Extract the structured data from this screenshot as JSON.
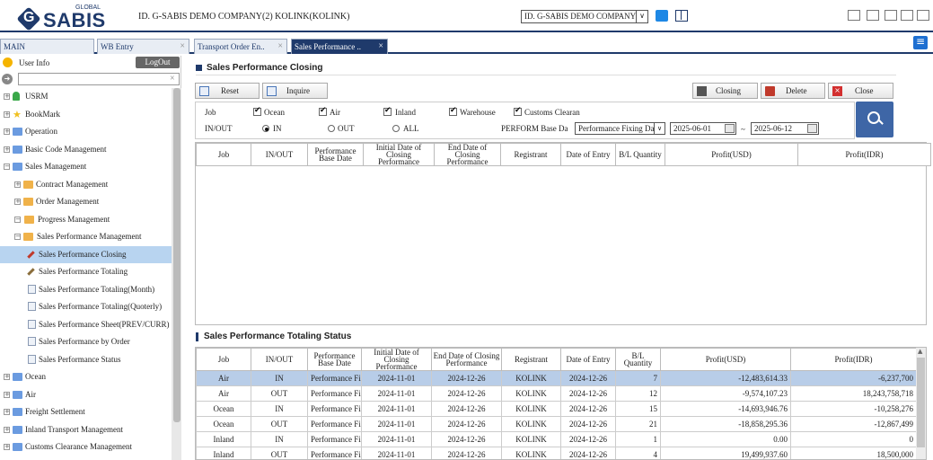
{
  "header": {
    "logo_global": "GLOBAL",
    "logo_word": "SABIS",
    "logo_mark": "G",
    "id_text": "ID. G-SABIS DEMO COMPANY(2) KOLINK(KOLINK)",
    "company_select": "ID. G-SABIS DEMO COMPANY",
    "icons": [
      "chat-icon",
      "book-icon",
      "window-cascade-icon",
      "window-tile-icon",
      "window-minimize-icon",
      "window-split-icon",
      "settings-icon"
    ]
  },
  "tabs": [
    {
      "label": "MAIN"
    },
    {
      "label": "WB Entry"
    },
    {
      "label": "Transport Order En.."
    },
    {
      "label": "Sales Performance .."
    }
  ],
  "sidebar": {
    "user_info": "User Info",
    "logout": "LogOut",
    "search_placeholder": "",
    "tree": [
      {
        "label": "USRM"
      },
      {
        "label": "BookMark"
      },
      {
        "label": "Operation"
      },
      {
        "label": "Basic Code Management"
      },
      {
        "label": "Sales Management"
      },
      {
        "label": "Contract Management"
      },
      {
        "label": "Order Management"
      },
      {
        "label": "Progress Management"
      },
      {
        "label": "Sales Performance Management"
      },
      {
        "label": "Sales Performance Closing"
      },
      {
        "label": "Sales Performance Totaling"
      },
      {
        "label": "Sales Performance Totaling(Month)"
      },
      {
        "label": "Sales Performance Totaling(Quoterly)"
      },
      {
        "label": "Sales Performance Sheet(PREV/CURR)"
      },
      {
        "label": "Sales Performance by Order"
      },
      {
        "label": "Sales Performance Status"
      },
      {
        "label": "Ocean"
      },
      {
        "label": "Air"
      },
      {
        "label": "Freight Settlement"
      },
      {
        "label": "Inland Transport Management"
      },
      {
        "label": "Customs Clearance Management"
      }
    ]
  },
  "main": {
    "title": "Sales Performance Closing",
    "buttons": {
      "reset": "Reset",
      "inquire": "Inquire",
      "closing": "Closing",
      "delete": "Delete",
      "close": "Close"
    },
    "filter": {
      "job_label": "Job",
      "job_options": [
        {
          "label": "Ocean",
          "checked": true
        },
        {
          "label": "Air",
          "checked": true
        },
        {
          "label": "Inland",
          "checked": true
        },
        {
          "label": "Warehouse",
          "checked": true
        },
        {
          "label": "Customs Clearanc",
          "checked": true
        }
      ],
      "inout_label": "IN/OUT",
      "inout_options": [
        {
          "label": "IN",
          "selected": true
        },
        {
          "label": "OUT",
          "selected": false
        },
        {
          "label": "ALL",
          "selected": false
        }
      ],
      "base_date_label": "PERFORM Base Da",
      "base_date_select": "Performance Fixing Da",
      "date_from": "2025-06-01",
      "date_sep": "~",
      "date_to": "2025-06-12"
    },
    "grid1": {
      "columns": [
        "Job",
        "IN/OUT",
        "Performance Base Date",
        "Initial Date of Closing Performance",
        "End Date of Closing Performance",
        "Registrant",
        "Date of Entry",
        "B/L Quantity",
        "Profit(USD)",
        "Profit(IDR)"
      ]
    },
    "status_title": "Sales Performance Totaling Status",
    "grid2": {
      "columns": [
        "Job",
        "IN/OUT",
        "Performance Base Date",
        "Initial Date of Closing Performance",
        "End Date of Closing Performance",
        "Registrant",
        "Date of Entry",
        "B/L Quantity",
        "Profit(USD)",
        "Profit(IDR)"
      ],
      "rows": [
        [
          "Air",
          "IN",
          "Performance Fix",
          "2024-11-01",
          "2024-12-26",
          "KOLINK",
          "2024-12-26",
          "7",
          "-12,483,614.33",
          "-6,237,700"
        ],
        [
          "Air",
          "OUT",
          "Performance Fix",
          "2024-11-01",
          "2024-12-26",
          "KOLINK",
          "2024-12-26",
          "12",
          "-9,574,107.23",
          "18,243,758,718"
        ],
        [
          "Ocean",
          "IN",
          "Performance Fix",
          "2024-11-01",
          "2024-12-26",
          "KOLINK",
          "2024-12-26",
          "15",
          "-14,693,946.76",
          "-10,258,276"
        ],
        [
          "Ocean",
          "OUT",
          "Performance Fix",
          "2024-11-01",
          "2024-12-26",
          "KOLINK",
          "2024-12-26",
          "21",
          "-18,858,295.36",
          "-12,867,499"
        ],
        [
          "Inland",
          "IN",
          "Performance Fix",
          "2024-11-01",
          "2024-12-26",
          "KOLINK",
          "2024-12-26",
          "1",
          "0.00",
          "0"
        ],
        [
          "Inland",
          "OUT",
          "Performance Fix",
          "2024-11-01",
          "2024-12-26",
          "KOLINK",
          "2024-12-26",
          "4",
          "19,499,937.60",
          "18,500,000"
        ]
      ]
    }
  }
}
